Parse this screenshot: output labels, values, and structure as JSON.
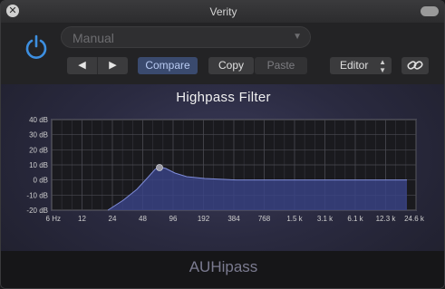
{
  "window": {
    "title": "Verity"
  },
  "titlebar": {
    "close_glyph": "✕"
  },
  "preset": {
    "value": "Manual",
    "arrow": "▼"
  },
  "toolbar": {
    "prev_label": "◀",
    "next_label": "▶",
    "compare_label": "Compare",
    "copy_label": "Copy",
    "paste_label": "Paste",
    "editor_label": "Editor",
    "editor_arrows": "▲▼"
  },
  "plugin": {
    "title": "Highpass Filter",
    "name": "AUHipass",
    "y_axis_labels": [
      "40 dB",
      "30 dB",
      "20 dB",
      "10 dB",
      "0 dB",
      "-10 dB",
      "-20 dB"
    ],
    "x_axis_labels": [
      "6 Hz",
      "12",
      "24",
      "48",
      "96",
      "192",
      "384",
      "768",
      "1.5 k",
      "3.1 k",
      "6.1 k",
      "12.3 k",
      "24.6 k"
    ],
    "accent_color": "#7f8cd8"
  },
  "icons": {
    "power": "power-icon",
    "link": "link-icon"
  }
}
